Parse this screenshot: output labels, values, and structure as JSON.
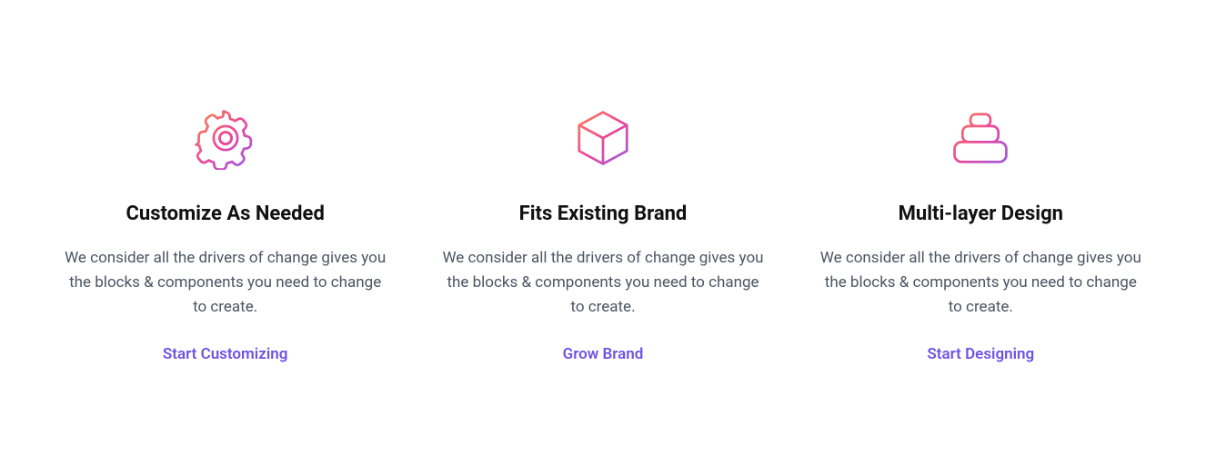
{
  "features": [
    {
      "title": "Customize As Needed",
      "desc": "We consider all the drivers of change gives you the blocks & components you need to change to create.",
      "link": "Start Customizing"
    },
    {
      "title": "Fits Existing Brand",
      "desc": "We consider all the drivers of change gives you the blocks & components you need to change to create.",
      "link": "Grow Brand"
    },
    {
      "title": "Multi-layer Design",
      "desc": "We consider all the drivers of change gives you the blocks & components you need to change to create.",
      "link": "Start Designing"
    }
  ]
}
